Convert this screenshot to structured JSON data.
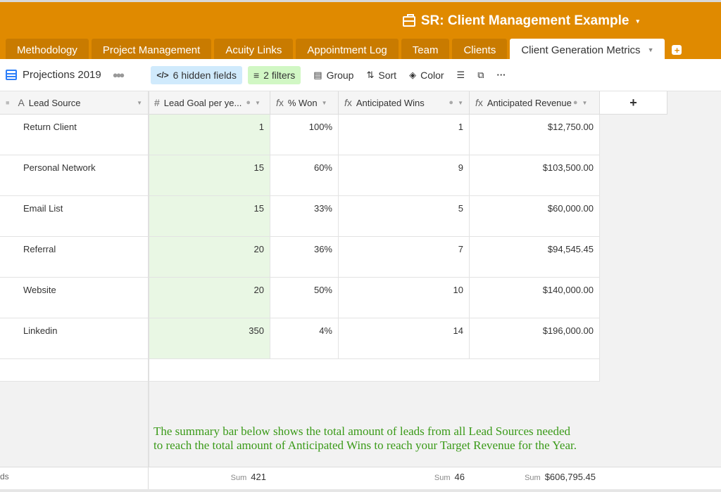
{
  "base": {
    "title": "SR: Client Management Example",
    "caret": "▾",
    "accent": "#e08a00"
  },
  "tabs": [
    {
      "label": "Methodology"
    },
    {
      "label": "Project Management"
    },
    {
      "label": "Acuity Links"
    },
    {
      "label": "Appointment Log"
    },
    {
      "label": "Team"
    },
    {
      "label": "Clients"
    },
    {
      "label": "Client Generation Metrics",
      "active": true
    }
  ],
  "toolbar": {
    "view_name": "Projections 2019",
    "hidden_fields": "6 hidden fields",
    "filters": "2 filters",
    "group": "Group",
    "sort": "Sort",
    "color": "Color"
  },
  "columns": {
    "lead_source": "Lead Source",
    "lead_goal": "Lead Goal per ye...",
    "pct_won": "% Won",
    "anticipated_wins": "Anticipated Wins",
    "anticipated_revenue": "Anticipated Revenue"
  },
  "rows": [
    {
      "lead_source": "Return Client",
      "lead_goal": "1",
      "pct_won": "100%",
      "wins": "1",
      "revenue": "$12,750.00"
    },
    {
      "lead_source": "Personal Network",
      "lead_goal": "15",
      "pct_won": "60%",
      "wins": "9",
      "revenue": "$103,500.00"
    },
    {
      "lead_source": "Email List",
      "lead_goal": "15",
      "pct_won": "33%",
      "wins": "5",
      "revenue": "$60,000.00"
    },
    {
      "lead_source": "Referral",
      "lead_goal": "20",
      "pct_won": "36%",
      "wins": "7",
      "revenue": "$94,545.45"
    },
    {
      "lead_source": "Website",
      "lead_goal": "20",
      "pct_won": "50%",
      "wins": "10",
      "revenue": "$140,000.00"
    },
    {
      "lead_source": "Linkedin",
      "lead_goal": "350",
      "pct_won": "4%",
      "wins": "14",
      "revenue": "$196,000.00"
    }
  ],
  "note": {
    "line1": "The summary bar below shows the total amount of leads from all Lead Sources needed",
    "line2": "to reach the total amount of Anticipated Wins to reach your Target Revenue for the Year."
  },
  "summary": {
    "left_text": "ds",
    "sum_label": "Sum",
    "lead_goal_sum": "421",
    "wins_sum": "46",
    "revenue_sum": "$606,795.45"
  },
  "icons": {
    "briefcase": "briefcase-icon",
    "grid": "grid-view-icon",
    "people": "collaborators-icon",
    "hidden": "eye-slash-icon",
    "filter": "filter-icon",
    "group": "group-icon",
    "sort": "sort-icon",
    "color": "paint-bucket-icon",
    "row_height": "row-height-icon",
    "share": "share-icon",
    "more": "more-icon",
    "formula": "formula-icon",
    "number": "number-icon",
    "text": "text-icon",
    "lock": "lock-icon",
    "add": "add-icon"
  }
}
